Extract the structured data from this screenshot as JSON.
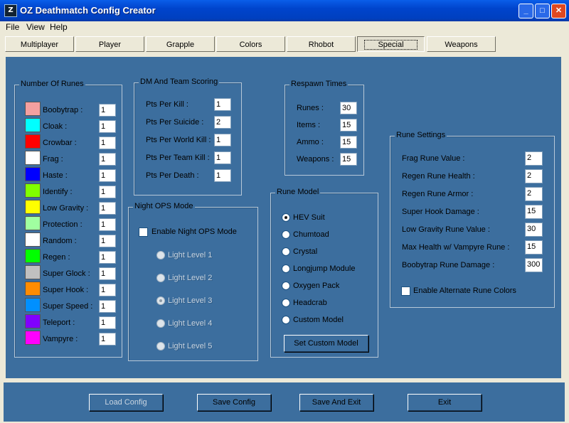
{
  "window": {
    "title": "OZ Deathmatch Config Creator",
    "icon_glyph": "Z",
    "min": "_",
    "max": "□",
    "close": "✕"
  },
  "menu": [
    "File",
    "View",
    "Help"
  ],
  "tabs": [
    "Multiplayer",
    "Player",
    "Grapple",
    "Colors",
    "Rhobot",
    "Special",
    "Weapons"
  ],
  "active_tab": "Special",
  "runes": {
    "title": "Number Of Runes",
    "items": [
      {
        "label": "Boobytrap :",
        "value": "1",
        "color": "#f4a0a0"
      },
      {
        "label": "Cloak :",
        "value": "1",
        "color": "#00ffff"
      },
      {
        "label": "Crowbar :",
        "value": "1",
        "color": "#ff0000"
      },
      {
        "label": "Frag :",
        "value": "1",
        "color": "#ffffff"
      },
      {
        "label": "Haste :",
        "value": "1",
        "color": "#0000ff"
      },
      {
        "label": "Identify :",
        "value": "1",
        "color": "#80ff00"
      },
      {
        "label": "Low Gravity :",
        "value": "1",
        "color": "#ffff00"
      },
      {
        "label": "Protection :",
        "value": "1",
        "color": "#a0ffa0"
      },
      {
        "label": "Random :",
        "value": "1",
        "color": "#ffffff"
      },
      {
        "label": "Regen :",
        "value": "1",
        "color": "#00ff00"
      },
      {
        "label": "Super Glock :",
        "value": "1",
        "color": "#c0c0c0"
      },
      {
        "label": "Super Hook :",
        "value": "1",
        "color": "#ff8c00"
      },
      {
        "label": "Super Speed :",
        "value": "1",
        "color": "#0090ff"
      },
      {
        "label": "Teleport :",
        "value": "1",
        "color": "#8000ff"
      },
      {
        "label": "Vampyre :",
        "value": "1",
        "color": "#ff00ff"
      }
    ]
  },
  "scoring": {
    "title": "DM And Team Scoring",
    "items": [
      {
        "label": "Pts Per Kill :",
        "value": "1"
      },
      {
        "label": "Pts Per Suicide :",
        "value": "2"
      },
      {
        "label": "Pts Per World Kill :",
        "value": "1"
      },
      {
        "label": "Pts Per Team Kill :",
        "value": "1"
      },
      {
        "label": "Pts Per Death :",
        "value": "1"
      }
    ]
  },
  "respawn": {
    "title": "Respawn Times",
    "items": [
      {
        "label": "Runes :",
        "value": "30"
      },
      {
        "label": "Items :",
        "value": "15"
      },
      {
        "label": "Ammo :",
        "value": "15"
      },
      {
        "label": "Weapons :",
        "value": "15"
      }
    ]
  },
  "night_ops": {
    "title": "Night OPS Mode",
    "enable_label": "Enable Night OPS Mode",
    "enabled": false,
    "levels": [
      "Light Level 1",
      "Light Level 2",
      "Light Level 3",
      "Light Level 4",
      "Light Level 5"
    ],
    "selected_level": "Light Level 3"
  },
  "rune_model": {
    "title": "Rune Model",
    "options": [
      "HEV Suit",
      "Chumtoad",
      "Crystal",
      "Longjump Module",
      "Oxygen Pack",
      "Headcrab",
      "Custom Model"
    ],
    "selected": "HEV Suit",
    "set_button": "Set Custom Model"
  },
  "rune_settings": {
    "title": "Rune Settings",
    "items": [
      {
        "label": "Frag Rune Value :",
        "value": "2"
      },
      {
        "label": "Regen Rune Health :",
        "value": "2"
      },
      {
        "label": "Regen Rune Armor :",
        "value": "2"
      },
      {
        "label": "Super Hook Damage :",
        "value": "15"
      },
      {
        "label": "Low Gravity Rune Value :",
        "value": "30"
      },
      {
        "label": "Max Health w/ Vampyre Rune :",
        "value": "15"
      },
      {
        "label": "Boobytrap Rune Damage :",
        "value": "300"
      }
    ],
    "alt_colors_label": "Enable Alternate Rune Colors",
    "alt_colors": false
  },
  "footer": {
    "load": "Load Config",
    "save": "Save Config",
    "save_exit": "Save And Exit",
    "exit": "Exit"
  }
}
